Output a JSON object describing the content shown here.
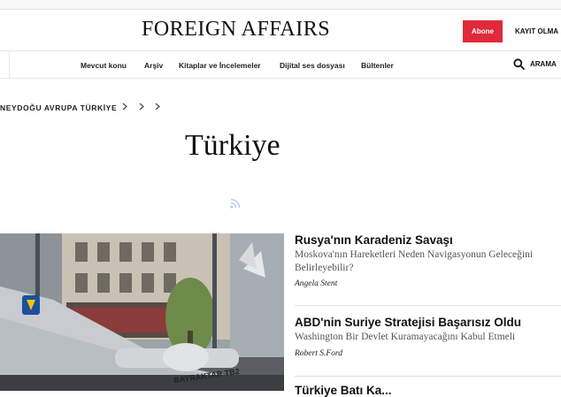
{
  "header": {
    "logo": "FOREIGN AFFAIRS",
    "subscribe_label": "Abone",
    "login_label": "KAYIT OLMA"
  },
  "nav": {
    "items": [
      "Mevcut konu",
      "Arşiv",
      "Kitaplar ve İncelemeler",
      "Dijital ses dosyası",
      "Bültenler"
    ],
    "search_label": "ARAMA"
  },
  "breadcrumb": {
    "text": "NEYDOĞU AVRUPA TÜRKİYE"
  },
  "page": {
    "title": "Türkiye",
    "rss_icon": "rss-icon"
  },
  "hero": {
    "image_text": "BAYRAKTAR TB2"
  },
  "articles": [
    {
      "headline": "Rusya'nın Karadeniz Savaşı",
      "dek": "Moskova'nın Hareketleri Neden Navigasyonun Geleceğini Belirleyebilir?",
      "author": "Angela Stent"
    },
    {
      "headline": "ABD'nin Suriye Stratejisi Başarısız Oldu",
      "dek": "Washington Bir Devlet Kuramayacağını Kabul Etmeli",
      "author": "Robert S.Ford"
    },
    {
      "headline": "Türkiye Batı Ka..."
    }
  ],
  "colors": {
    "accent": "#e0293a",
    "text": "#111111",
    "muted": "#555555",
    "rss": "#b9cfe6"
  }
}
